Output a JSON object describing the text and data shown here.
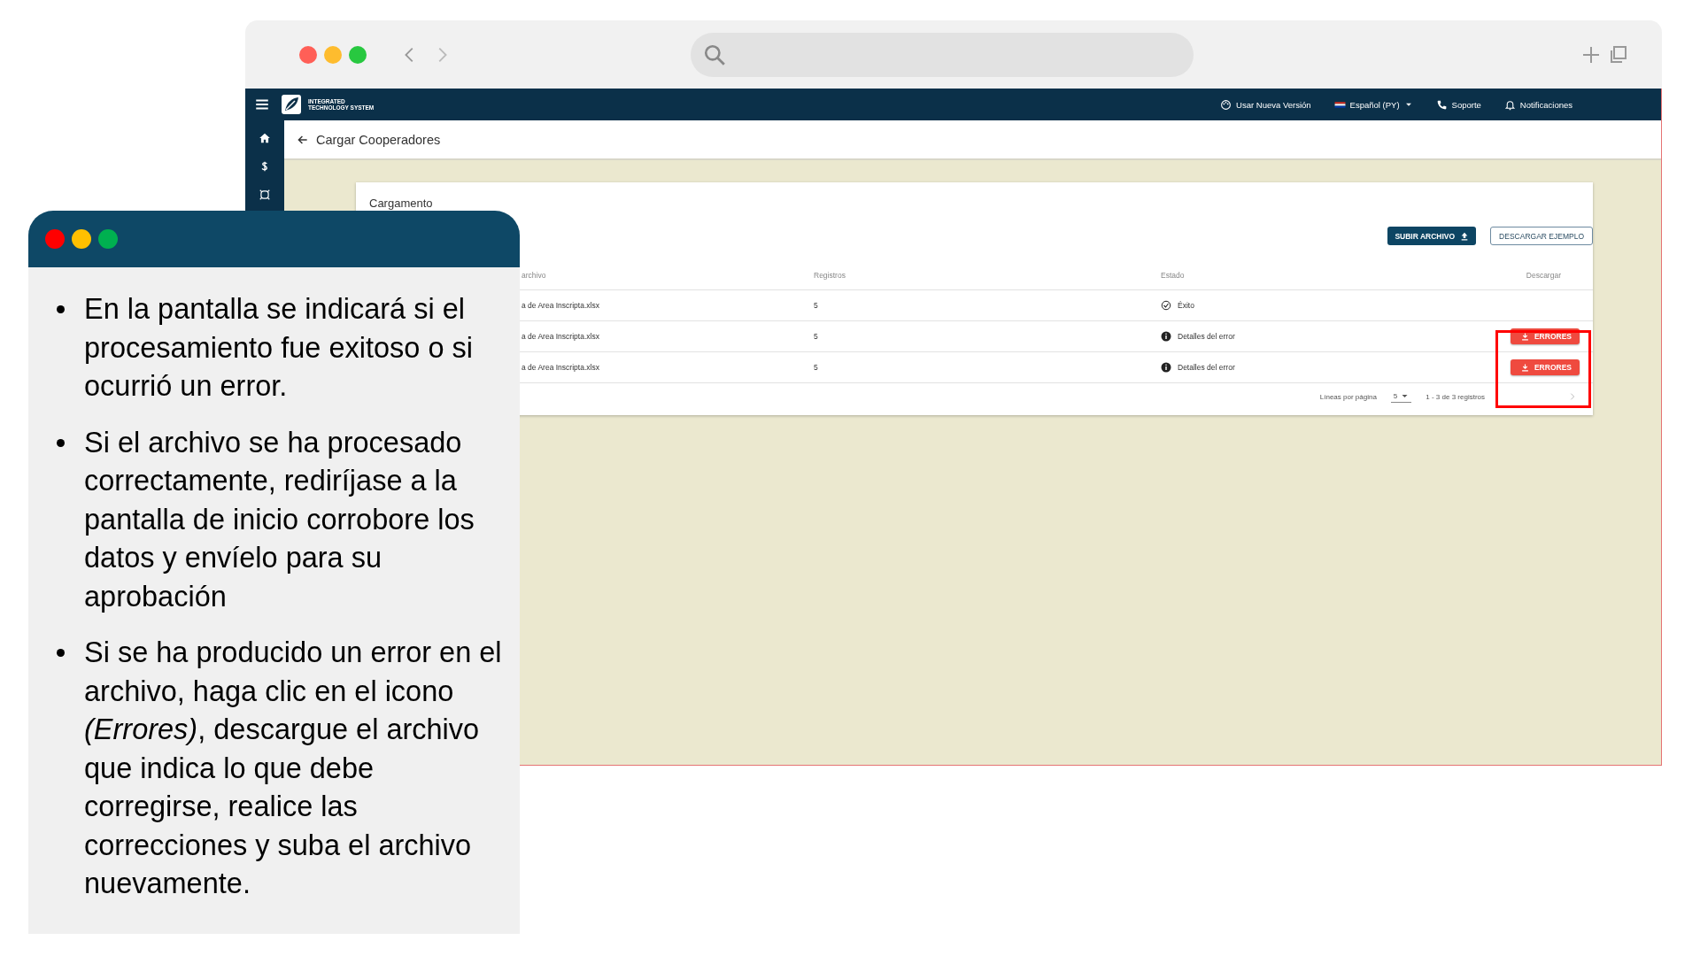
{
  "app": {
    "brand": [
      "INTEGRATED",
      "TECHNOLOGY SYSTEM"
    ],
    "header_actions": [
      {
        "kind": "palette",
        "label": "Usar Nueva Versión",
        "dropdown": false
      },
      {
        "kind": "flag",
        "label": "Español (PY)",
        "dropdown": true
      },
      {
        "kind": "phone",
        "label": "Soporte",
        "dropdown": false
      },
      {
        "kind": "bell",
        "label": "Notificaciones",
        "dropdown": false
      }
    ],
    "sidebar": {
      "items": [
        {
          "kind": "home"
        },
        {
          "kind": "dollar"
        },
        {
          "kind": "frame"
        }
      ]
    },
    "page_title": "Cargar Cooperadores",
    "card": {
      "title": "Cargamento",
      "buttons": [
        {
          "kind": "primary",
          "label": "SUBIR ARCHIVO"
        },
        {
          "kind": "outline",
          "label": "DESCARGAR EJEMPLO"
        }
      ],
      "table": {
        "columns": [
          "archivo",
          "Registros",
          "Estado",
          "Descargar"
        ],
        "rows": [
          {
            "file": "a de Area Inscripta.xlsx",
            "records": "5",
            "status": {
              "kind": "success",
              "text": "Éxito"
            }
          },
          {
            "file": "a de Area Inscripta.xlsx",
            "records": "5",
            "status": {
              "kind": "error",
              "text": "Detalles del error"
            },
            "download": "ERRORES"
          },
          {
            "file": "a de Area Inscripta.xlsx",
            "records": "5",
            "status": {
              "kind": "error",
              "text": "Detalles del error"
            },
            "download": "ERRORES"
          }
        ]
      },
      "pagination": {
        "label": "Líneas por página",
        "per_page": "5",
        "range": "1 - 3 de 3 registros"
      }
    }
  },
  "note": {
    "bullets": [
      "En la pantalla se indicará si el procesamiento fue exitoso o si ocurrió un error.",
      "Si el archivo se ha procesado correctamente, rediríjase a la pantalla de inicio corrobore los datos y envíelo para su aprobación",
      "Si se ha producido un error en el archivo, haga clic en el icono *(Errores)*, descargue el archivo que indica lo que debe corregirse, realice las correcciones y suba el archivo nuevamente."
    ]
  }
}
